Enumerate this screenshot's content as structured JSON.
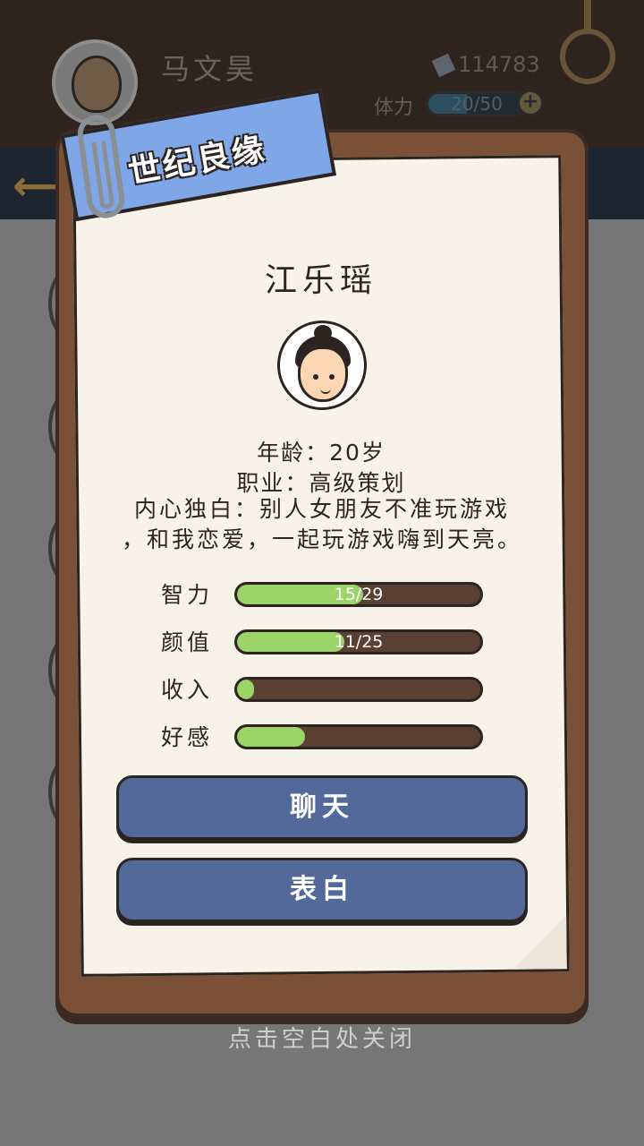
{
  "header": {
    "player_name": "马文昊",
    "money": "114783",
    "stamina_label": "体力",
    "stamina_value": "20/50",
    "stamina_fraction": 0.4
  },
  "hint": {
    "close": "点击空白处关闭"
  },
  "card": {
    "banner": "世纪良缘",
    "name": "江乐瑶",
    "age": "年龄：20岁",
    "job": "职业：高级策划",
    "monologue_line1": "内心独白：别人女朋友不准玩游戏",
    "monologue_line2": "，和我恋爱，一起玩游戏嗨到天亮。",
    "stats": [
      {
        "label": "智力",
        "value": 15,
        "max": 29,
        "text": "15/29"
      },
      {
        "label": "颜值",
        "value": 11,
        "max": 25,
        "text": "11/25"
      },
      {
        "label": "收入",
        "fraction": 0.07,
        "text": ""
      },
      {
        "label": "好感",
        "fraction": 0.28,
        "text": ""
      }
    ],
    "buttons": {
      "chat": "聊天",
      "confess": "表白"
    }
  },
  "colors": {
    "paper": "#f8f3e9",
    "clipboard": "#7a5036",
    "banner": "#7fa6e6",
    "bar_fill": "#9bd567",
    "button": "#52699a"
  }
}
